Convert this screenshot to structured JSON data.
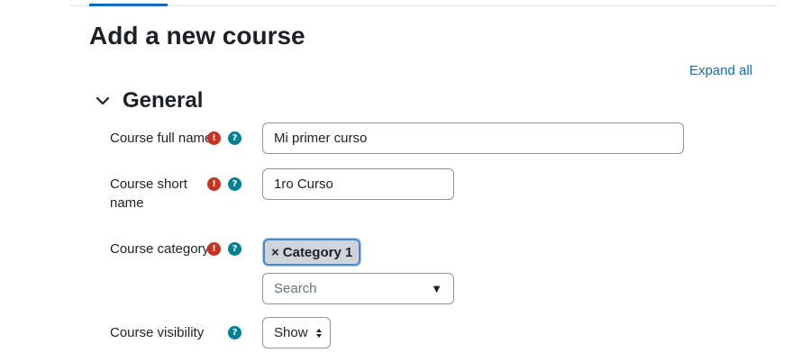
{
  "page": {
    "title": "Add a new course",
    "expand_all": "Expand all"
  },
  "section": {
    "title": "General"
  },
  "fields": {
    "full_name": {
      "label": "Course full name",
      "value": "Mi primer curso"
    },
    "short_name": {
      "label_line1": "Course short",
      "label_line2": "name",
      "value": "1ro Curso"
    },
    "category": {
      "label": "Course category",
      "selected_tag": "Category 1",
      "remove_symbol": "×",
      "search_placeholder": "Search",
      "dropdown_symbol": "▼"
    },
    "visibility": {
      "label": "Course visibility",
      "value": "Show"
    }
  },
  "icons": {
    "required": "!",
    "help": "?"
  },
  "colors": {
    "link": "#0f6cbf",
    "required": "#ca3120",
    "help": "#008196"
  }
}
